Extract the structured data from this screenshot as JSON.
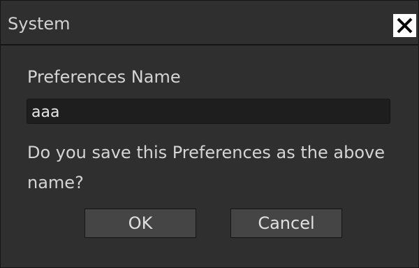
{
  "dialog": {
    "title": "System",
    "close_icon": "close-icon",
    "label": "Preferences Name",
    "input_value": "aaa",
    "message": "Do you save this Preferences as the above name?",
    "ok_label": "OK",
    "cancel_label": "Cancel"
  },
  "colors": {
    "background": "#2f2f2f",
    "input_background": "#1e1e1e",
    "button_background": "#454545",
    "text": "#d4d4d4",
    "close_button": "#ffffff"
  }
}
